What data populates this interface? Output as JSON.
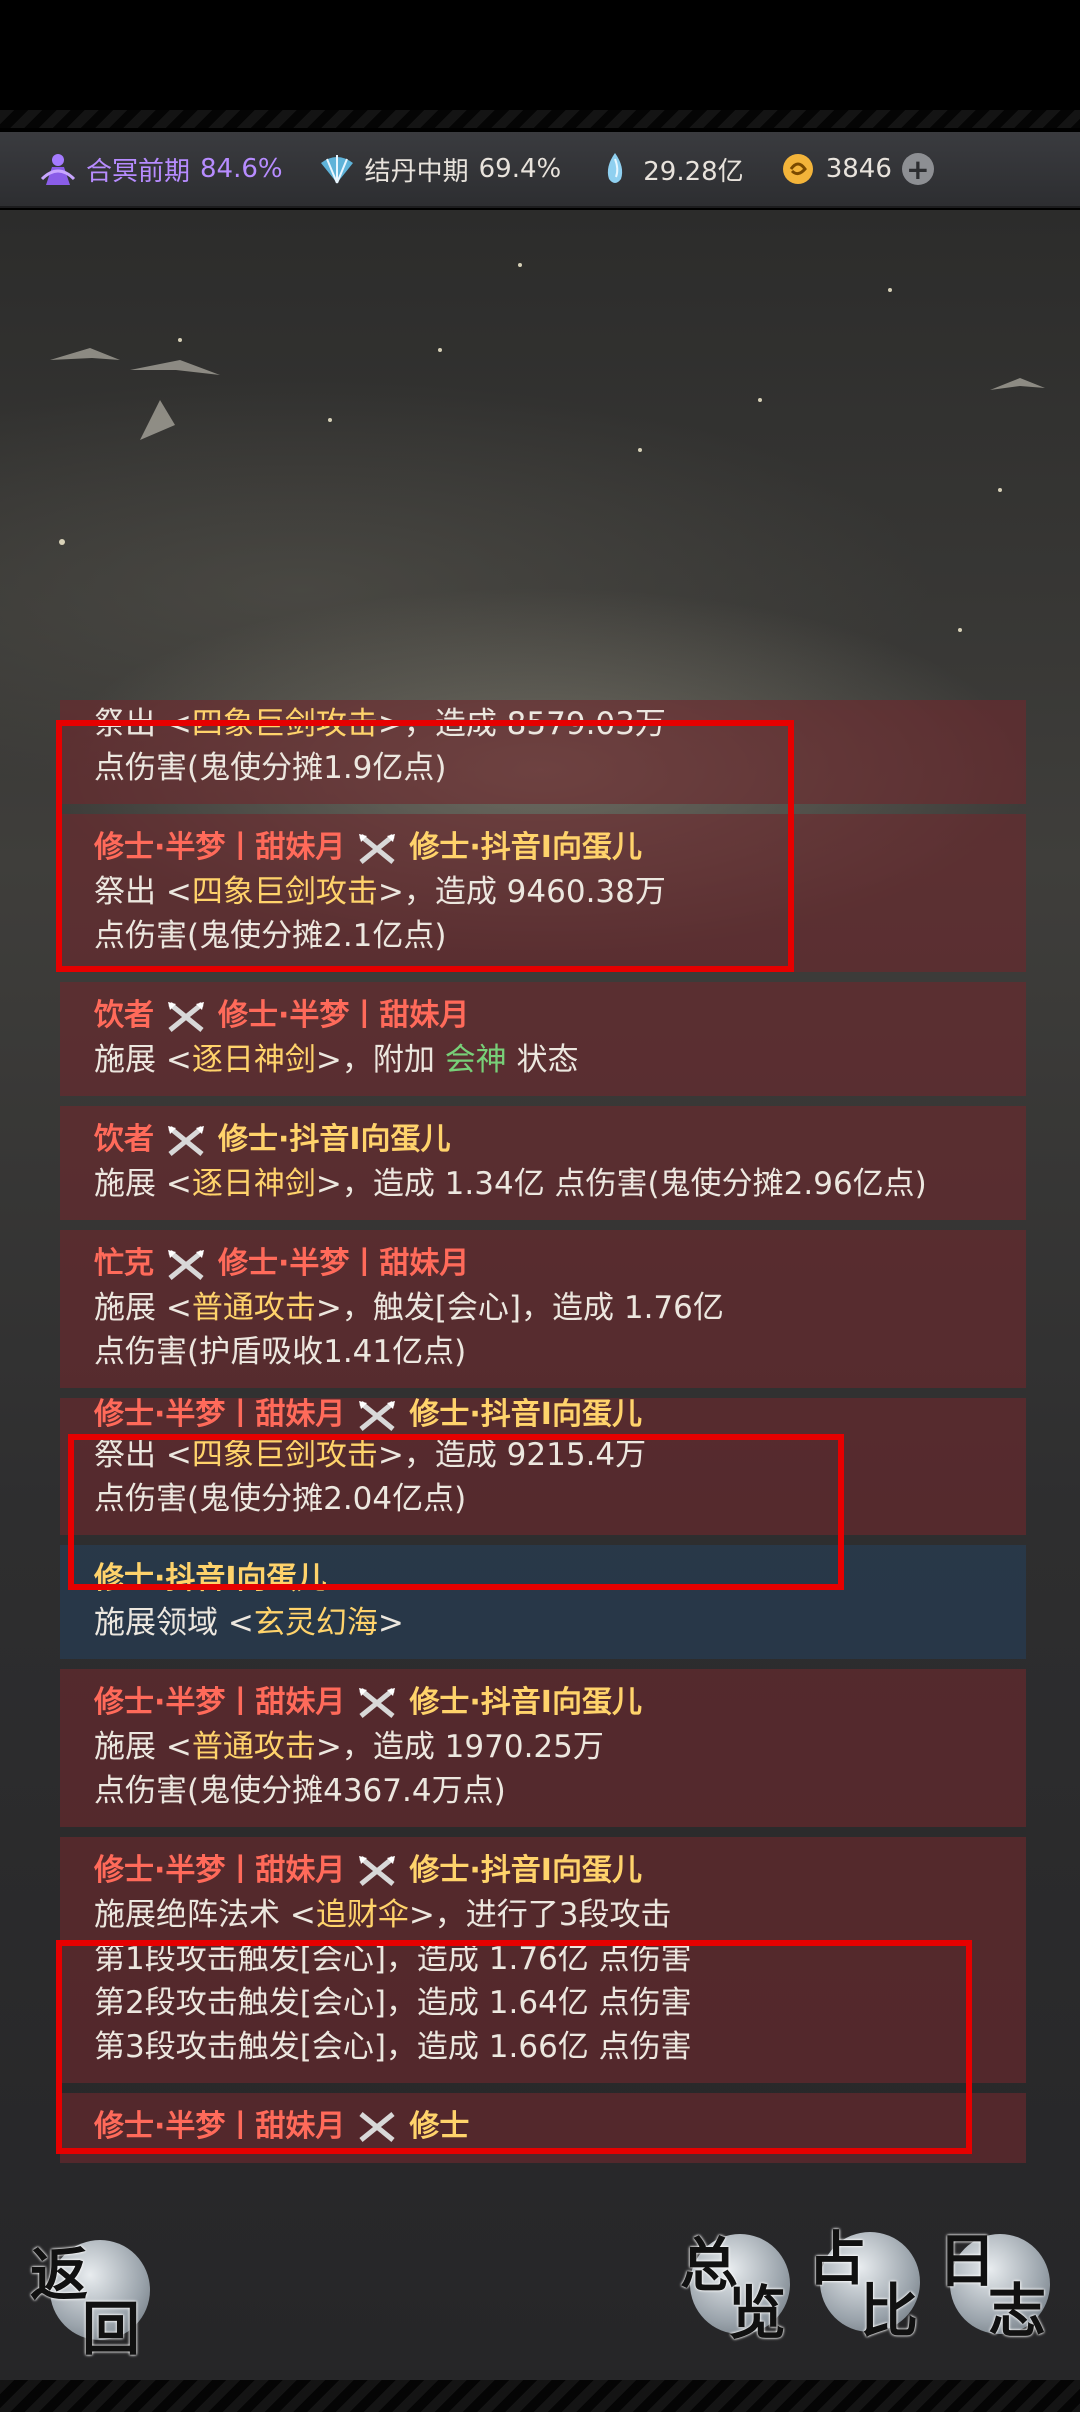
{
  "resources": [
    {
      "label": "合冥前期",
      "value": "84.6%",
      "icon": "purple-figure-icon",
      "color": "#b78cff"
    },
    {
      "label": "结丹中期",
      "value": "69.4%",
      "icon": "fan-icon",
      "color": "#ffffff"
    },
    {
      "label": "",
      "value": "29.28亿",
      "icon": "spirit-stone-icon",
      "color": "#ffffff"
    },
    {
      "label": "",
      "value": "3846",
      "icon": "gold-coin-icon",
      "color": "#ffffff"
    }
  ],
  "log": {
    "e1": {
      "l1a": "祭出 <",
      "l1b": "四象巨剑攻击",
      "l1c": ">，造成 8579.03万",
      "l2": "点伤害(鬼使分摊1.9亿点)"
    },
    "e2": {
      "h1": "修士·半梦丨甜妹月",
      "h2": "修士·抖音I向蛋儿",
      "l1a": "祭出 <",
      "l1b": "四象巨剑攻击",
      "l1c": ">，造成 9460.38万",
      "l2": "点伤害(鬼使分摊2.1亿点)"
    },
    "e3": {
      "h1": "饮者",
      "h2": "修士·半梦丨甜妹月",
      "l1a": "施展 <",
      "l1b": "逐日神剑",
      "l1c": ">，附加 ",
      "l1d": "会神",
      "l1e": " 状态"
    },
    "e4": {
      "h1": "饮者",
      "h2": "修士·抖音I向蛋儿",
      "l1a": "施展 <",
      "l1b": "逐日神剑",
      "l1c": ">，造成 1.34亿 点伤害(鬼使分摊2.96亿点)"
    },
    "e5": {
      "h1": "忙克",
      "h2": "修士·半梦丨甜妹月",
      "l1a": "施展 <",
      "l1b": "普通攻击",
      "l1c": ">，触发[会心]，造成 1.76亿",
      "l2": "点伤害(护盾吸收1.41亿点)"
    },
    "e6": {
      "h1": "修士·半梦丨甜妹月",
      "h2": "修士·抖音I向蛋儿",
      "l1a": "祭出 <",
      "l1b": "四象巨剑攻击",
      "l1c": ">，造成 9215.4万",
      "l2": "点伤害(鬼使分摊2.04亿点)"
    },
    "e7": {
      "h1": "修士·抖音I向蛋儿",
      "l1a": "施展领域 <",
      "l1b": "玄灵幻海",
      "l1c": ">"
    },
    "e8": {
      "h1": "修士·半梦丨甜妹月",
      "h2": "修士·抖音I向蛋儿",
      "l1a": "施展 <",
      "l1b": "普通攻击",
      "l1c": ">，造成 1970.25万",
      "l2": "点伤害(鬼使分摊4367.4万点)"
    },
    "e9": {
      "h1": "修士·半梦丨甜妹月",
      "h2": "修士·抖音I向蛋儿",
      "l1a": "施展绝阵法术 <",
      "l1b": "追财伞",
      "l1c": ">，进行了3段攻击",
      "l2": "第1段攻击触发[会心]，造成 1.76亿 点伤害",
      "l3": "第2段攻击触发[会心]，造成 1.64亿 点伤害",
      "l4": "第3段攻击触发[会心]，造成 1.66亿 点伤害"
    },
    "e10": {
      "h1": "修士·半梦丨甜妹月",
      "h2": "修士"
    }
  },
  "buttons": {
    "back": {
      "c1": "返",
      "c2": "回"
    },
    "overview": {
      "c1": "总",
      "c2": "览"
    },
    "ratio": {
      "c1": "占",
      "c2": "比"
    },
    "log": {
      "c1": "日",
      "c2": "志"
    }
  },
  "colors": {
    "highlight_box": "#e60000",
    "attacker": "#ff6a5a",
    "target": "#ffd36b",
    "skill": "#ffd36b",
    "status": "#78d078"
  }
}
